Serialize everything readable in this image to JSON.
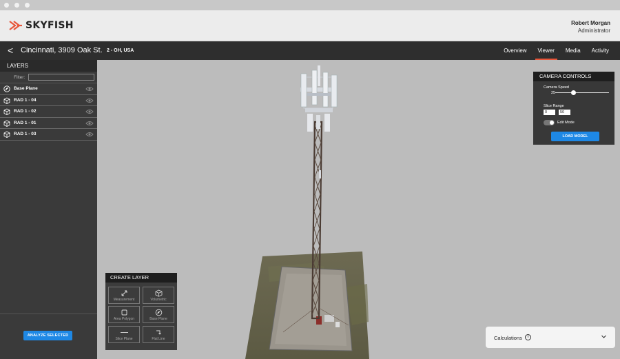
{
  "app": {
    "logo_text": "SKYFISH",
    "user": {
      "name": "Robert Morgan",
      "role": "Administrator"
    }
  },
  "toolbar": {
    "back_icon": "<",
    "site_title": "Cincinnati, 3909 Oak St.",
    "site_subtitle": "2 - OH, USA",
    "tabs": [
      {
        "label": "Overview",
        "active": false
      },
      {
        "label": "Viewer",
        "active": true
      },
      {
        "label": "Media",
        "active": false
      },
      {
        "label": "Activity",
        "active": false
      }
    ]
  },
  "layers": {
    "header": "LAYERS",
    "filter_label": "Filter:",
    "filter_value": "",
    "items": [
      {
        "label": "Base Plane",
        "icon": "base-plane-icon"
      },
      {
        "label": "RAD 1 - 04",
        "icon": "cube-icon"
      },
      {
        "label": "RAD 1 - 02",
        "icon": "cube-icon"
      },
      {
        "label": "RAD 1 - 01",
        "icon": "cube-icon"
      },
      {
        "label": "RAD 1 - 03",
        "icon": "cube-icon"
      }
    ],
    "analyze_label": "ANALYZE SELECTED"
  },
  "camera": {
    "header": "CAMERA CONTROLS",
    "speed_label": "Camera Speed",
    "speed_value": "25",
    "slice_label": "Slice Range",
    "slice_min": "0",
    "slice_max": "50",
    "edit_label": "Edit Mode",
    "load_label": "LOAD MODEL"
  },
  "create_layer": {
    "header": "CREATE LAYER",
    "tools": [
      {
        "label": "Measurement",
        "icon": "measurement-icon"
      },
      {
        "label": "Volumetric",
        "icon": "cube-icon"
      },
      {
        "label": "Area Polygon",
        "icon": "square-icon"
      },
      {
        "label": "Base Plane",
        "icon": "base-plane-icon"
      },
      {
        "label": "Slice Plane",
        "icon": "line-icon"
      },
      {
        "label": "Flat Line",
        "icon": "flat-line-icon"
      }
    ]
  },
  "calculations": {
    "label": "Calculations",
    "info": "i"
  },
  "colors": {
    "accent": "#e8563a",
    "primary_button": "#1e88e5",
    "panel": "#3a3a3a",
    "toolbar": "#2e2e2e"
  }
}
